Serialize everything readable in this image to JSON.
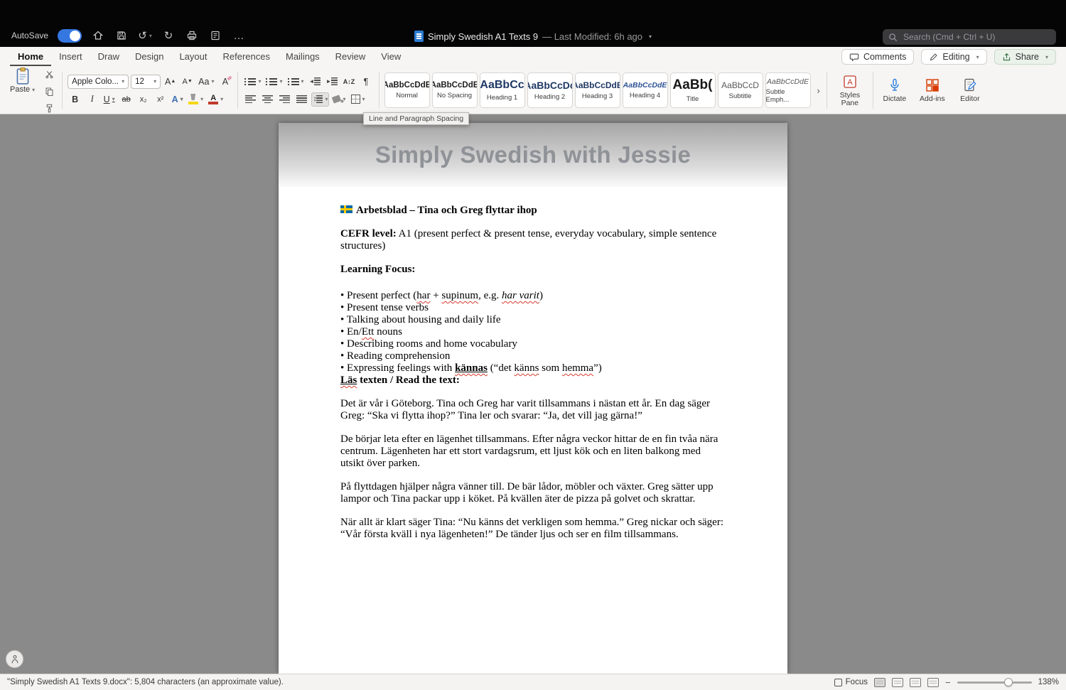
{
  "titlebar": {
    "autosave_label": "AutoSave",
    "doc_title": "Simply Swedish A1 Texts 9",
    "doc_modified": "— Last Modified: 6h ago",
    "search_placeholder": "Search (Cmd + Ctrl + U)"
  },
  "ribbon": {
    "tabs": [
      "Home",
      "Insert",
      "Draw",
      "Design",
      "Layout",
      "References",
      "Mailings",
      "Review",
      "View"
    ],
    "active_tab": "Home",
    "comments_label": "Comments",
    "editing_label": "Editing",
    "share_label": "Share",
    "paste_label": "Paste",
    "font_name": "Apple Colo...",
    "font_size": "12",
    "styles": [
      {
        "preview": "AaBbCcDdE",
        "label": "Normal"
      },
      {
        "preview": "AaBbCcDdE",
        "label": "No Spacing"
      },
      {
        "preview": "AaBbCc",
        "label": "Heading 1"
      },
      {
        "preview": "AaBbCcDc",
        "label": "Heading 2"
      },
      {
        "preview": "AaBbCcDdE",
        "label": "Heading 3"
      },
      {
        "preview": "AaBbCcDdE",
        "label": "Heading 4"
      },
      {
        "preview": "AaBb(",
        "label": "Title"
      },
      {
        "preview": "AaBbCcD",
        "label": "Subtitle"
      },
      {
        "preview": "AaBbCcDdE",
        "label": "Subtle Emph..."
      }
    ],
    "styles_pane_label": "Styles Pane",
    "dictate_label": "Dictate",
    "addins_label": "Add-ins",
    "editor_label": "Editor",
    "tooltip": "Line and Paragraph Spacing"
  },
  "document": {
    "banner_title": "Simply Swedish with Jessie",
    "heading": "Arbetsblad – Tina och Greg flyttar ihop",
    "cefr_label": "CEFR level:",
    "cefr_text": " A1 (present perfect & present tense, everyday vocabulary, simple sentence structures)",
    "learning_focus_label": "Learning Focus:",
    "bullets": [
      [
        {
          "t": "• Present perfect ("
        },
        {
          "t": "har",
          "w": 1
        },
        {
          "t": " + "
        },
        {
          "t": "supinum",
          "w": 1
        },
        {
          "t": ", e.g. "
        },
        {
          "t": "har varit",
          "i": 1,
          "w": 1
        },
        {
          "t": ")"
        }
      ],
      [
        {
          "t": "• Present tense verbs"
        }
      ],
      [
        {
          "t": "• Talking about housing and daily life"
        }
      ],
      [
        {
          "t": "• En/"
        },
        {
          "t": "Ett",
          "w": 1
        },
        {
          "t": " nouns"
        }
      ],
      [
        {
          "t": "• Describing rooms and home vocabulary"
        }
      ],
      [
        {
          "t": "• Reading comprehension"
        }
      ],
      [
        {
          "t": "• Expressing feelings with "
        },
        {
          "t": "kännas",
          "b": 1,
          "u": 1,
          "w": 1
        },
        {
          "t": " (“det "
        },
        {
          "t": "känns",
          "w": 1
        },
        {
          "t": " som "
        },
        {
          "t": "hemma",
          "w": 1
        },
        {
          "t": "”)"
        }
      ]
    ],
    "read_label": [
      {
        "t": "Läs",
        "b": 1,
        "u": 1,
        "w": 1
      },
      {
        "t": " texten / Read the text:",
        "b": 1
      }
    ],
    "paragraphs": [
      "Det är vår i Göteborg. Tina och Greg har varit tillsammans i nästan ett år. En dag säger Greg: “Ska vi flytta ihop?” Tina ler och svarar: “Ja, det vill jag gärna!”",
      "De börjar leta efter en lägenhet tillsammans. Efter några veckor hittar de en fin tvåa nära centrum. Lägenheten har ett stort vardagsrum, ett ljust kök och en liten balkong med utsikt över parken.",
      "På flyttdagen hjälper några vänner till. De bär lådor, möbler och växter. Greg sätter upp lampor och Tina packar upp i köket. På kvällen äter de pizza på golvet och skrattar.",
      "När allt är klart säger Tina: “Nu känns det verkligen som hemma.” Greg nickar och säger: “Vår första kväll i nya lägenheten!” De tänder ljus och ser en film tillsammans."
    ]
  },
  "statusbar": {
    "left_text": "\"Simply Swedish A1 Texts 9.docx\": 5,804 characters (an approximate value).",
    "focus_label": "Focus",
    "zoom_level": "138%"
  },
  "colors": {
    "accent_blue": "#2b7cd3",
    "heading_blue": "#1f3864",
    "spell_red": "#d83a2e",
    "addins_red": "#d83b01",
    "highlight_yellow": "#f7d718"
  }
}
